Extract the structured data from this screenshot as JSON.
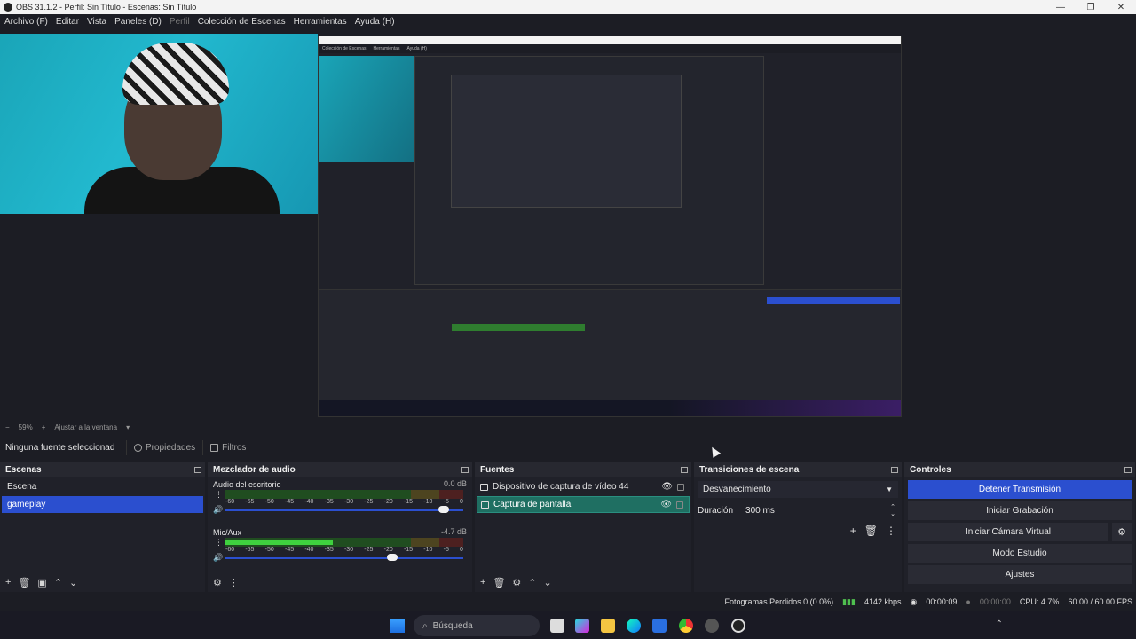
{
  "window": {
    "title": "OBS 31.1.2 - Perfil: Sin Título - Escenas: Sin Título"
  },
  "menu": [
    {
      "label": "Archivo (F)",
      "disabled": false
    },
    {
      "label": "Editar",
      "disabled": false
    },
    {
      "label": "Vista",
      "disabled": false
    },
    {
      "label": "Paneles (D)",
      "disabled": false
    },
    {
      "label": "Perfil",
      "disabled": true
    },
    {
      "label": "Colección de Escenas",
      "disabled": false
    },
    {
      "label": "Herramientas",
      "disabled": false
    },
    {
      "label": "Ayuda (H)",
      "disabled": false
    }
  ],
  "zoom": {
    "minus": "−",
    "value": "59%",
    "plus": "+",
    "fit": "Ajustar a la ventana"
  },
  "sourcebar": {
    "no_selection": "Ninguna fuente seleccionad",
    "properties": "Propiedades",
    "filters": "Filtros"
  },
  "scenes": {
    "title": "Escenas",
    "items": [
      {
        "label": "Escena",
        "active": false
      },
      {
        "label": "gameplay",
        "active": true
      }
    ]
  },
  "mixer": {
    "title": "Mezclador de audio",
    "ticks": [
      "-60",
      "-55",
      "-50",
      "-45",
      "-40",
      "-35",
      "-30",
      "-25",
      "-20",
      "-15",
      "-10",
      "-5",
      "0"
    ],
    "channels": [
      {
        "name": "Audio del escritorio",
        "db": "0.0 dB",
        "level": 0.0,
        "volume": 1.0
      },
      {
        "name": "Mic/Aux",
        "db": "-4.7 dB",
        "level": 0.48,
        "volume": 0.76
      }
    ]
  },
  "sources": {
    "title": "Fuentes",
    "items": [
      {
        "label": "Dispositivo de captura de vídeo 44",
        "active": false
      },
      {
        "label": "Captura de pantalla",
        "active": true
      }
    ]
  },
  "transitions": {
    "title": "Transiciones de escena",
    "selected": "Desvanecimiento",
    "duration_label": "Duración",
    "duration_value": "300 ms"
  },
  "controls": {
    "title": "Controles",
    "stop_stream": "Detener Transmisión",
    "start_record": "Iniciar Grabación",
    "start_virtualcam": "Iniciar Cámara Virtual",
    "studio_mode": "Modo Estudio",
    "settings": "Ajustes"
  },
  "status": {
    "dropped": "Fotogramas Perdidos 0 (0.0%)",
    "bitrate": "4142 kbps",
    "stream_time": "00:00:09",
    "record_time": "00:00:00",
    "cpu": "CPU: 4.7%",
    "fps": "60.00 / 60.00 FPS"
  },
  "taskbar": {
    "search_placeholder": "Búsqueda"
  },
  "nested": {
    "menu": [
      "Colección de Escenas",
      "Herramientas",
      "Ayuda (H)"
    ]
  },
  "colors": {
    "accent": "#2b4fcf",
    "active_source": "#1f6f62"
  }
}
